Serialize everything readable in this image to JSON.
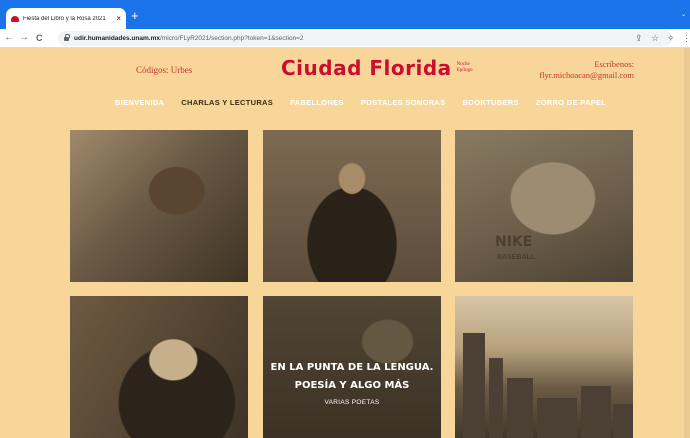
{
  "browser": {
    "tab_title": "Fiesta del Libro y la Rosa 2021",
    "tab_close": "×",
    "new_tab": "+",
    "url_host": "udir.humanidades.unam.mx",
    "url_path": "/micro/FLyR2021/section.php?token=1&section=2",
    "back": "←",
    "forward": "→",
    "reload": "C",
    "icons": [
      "share-icon",
      "star-icon",
      "extension-icon",
      "menu-icon"
    ]
  },
  "site": {
    "codigos": "Códigos: Urbes",
    "brand_title": "Ciudad Florida",
    "brand_sub_1": "Noche",
    "brand_sub_2": "Epílogo",
    "contact_label": "Escríbenos:",
    "contact_email": "flyr.michoacan@gmail.com"
  },
  "nav": [
    {
      "label": "BIENVENIDA",
      "active": false
    },
    {
      "label": "CHARLAS Y LECTURAS",
      "active": true
    },
    {
      "label": "PABELLONES",
      "active": false
    },
    {
      "label": "POSTALES SONORAS",
      "active": false
    },
    {
      "label": "BOOKTUBERS",
      "active": false
    },
    {
      "label": "ZORRO DE PAPEL",
      "active": false
    }
  ],
  "tiles": {
    "shirt_text": "NIKE",
    "shirt_text_2": "BASEBALL",
    "featured_title_1": "EN LA PUNTA DE LA LENGUA.",
    "featured_title_2": "POESÍA Y ALGO MÁS",
    "featured_sub": "VARIAS POETAS"
  },
  "colors": {
    "page_bg": "#f8d69a",
    "brand_red": "#c8102e",
    "chrome_blue": "#1a73e8"
  }
}
